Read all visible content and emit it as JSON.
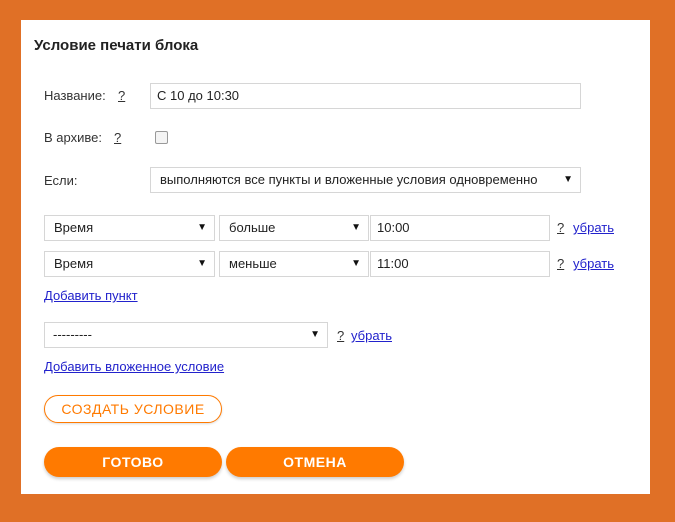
{
  "dialog": {
    "title": "Условие печати блока"
  },
  "fields": {
    "name_label": "Название:",
    "name_help": "?",
    "name_value": "С 10 до 10:30",
    "archive_label": "В архиве:",
    "archive_help": "?",
    "archive_checked": false,
    "if_label": "Если:",
    "if_value": "выполняются все пункты и вложенные условия одновременно"
  },
  "conditions": [
    {
      "field": "Время",
      "operator": "больше",
      "value": "10:00",
      "help": "?",
      "remove": "убрать"
    },
    {
      "field": "Время",
      "operator": "меньше",
      "value": "11:00",
      "help": "?",
      "remove": "убрать"
    }
  ],
  "add_item": "Добавить пункт",
  "nested": {
    "value": "---------",
    "help": "?",
    "remove": "убрать"
  },
  "add_nested": "Добавить вложенное условие",
  "buttons": {
    "create": "СОЗДАТЬ УСЛОВИЕ",
    "done": "ГОТОВО",
    "cancel": "ОТМЕНА"
  },
  "icons": {
    "dropdown": "▼"
  },
  "colors": {
    "accent": "#ff7a00",
    "background": "#e07026"
  }
}
